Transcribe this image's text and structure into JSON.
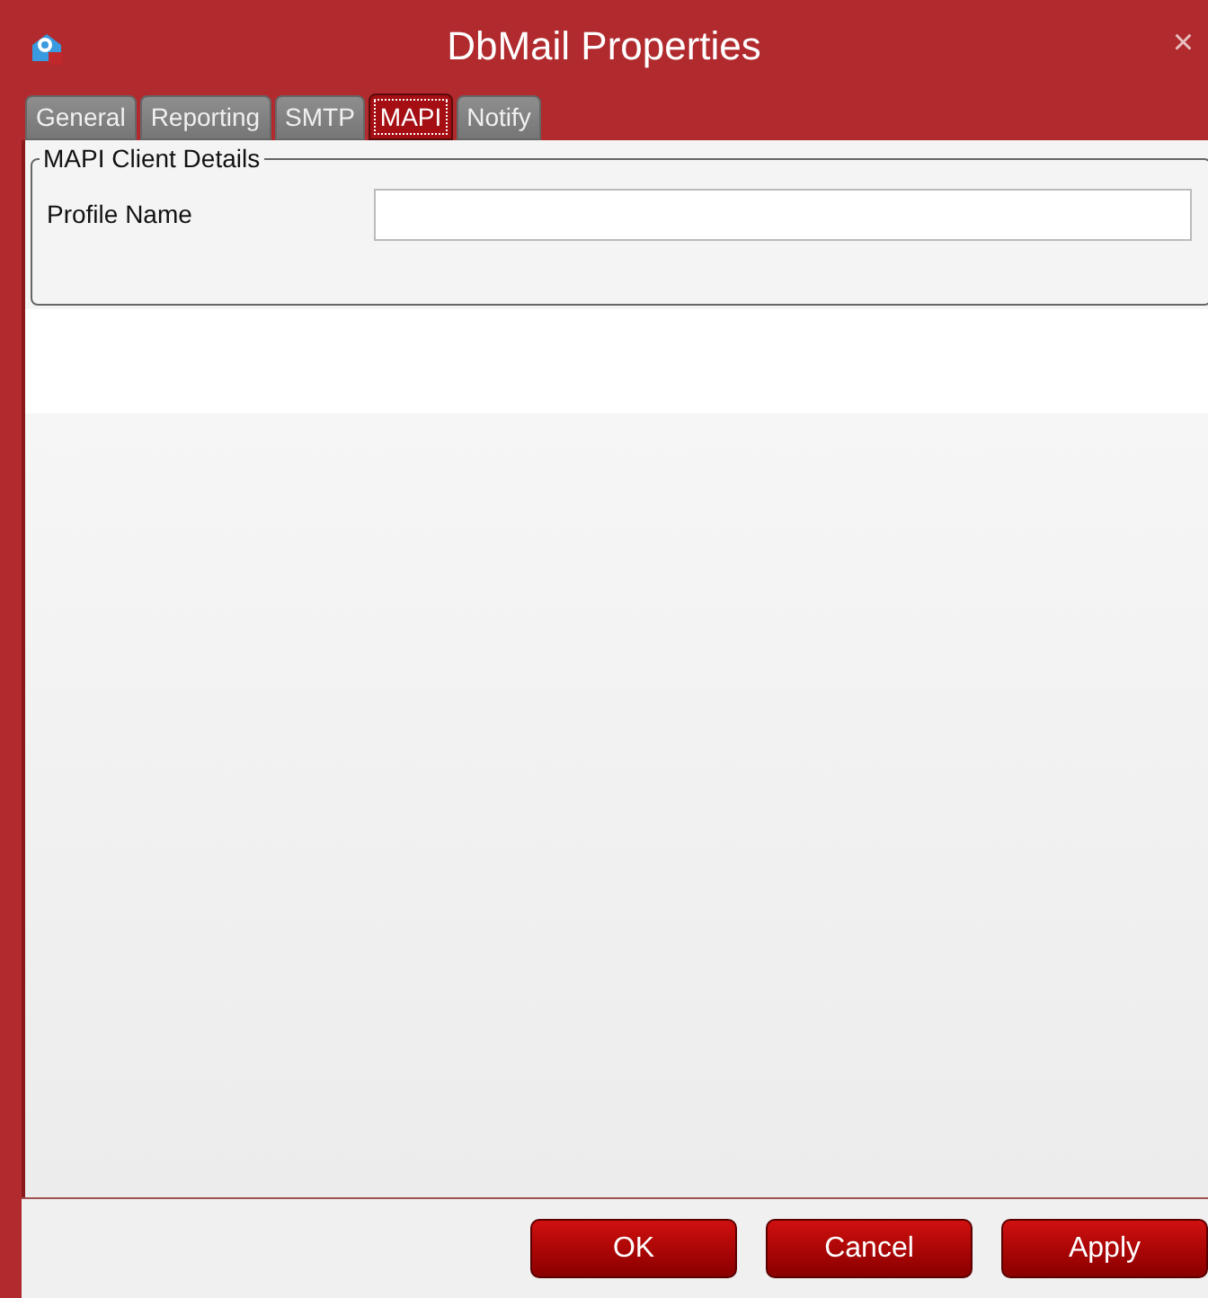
{
  "window": {
    "title": "DbMail Properties",
    "close": "×"
  },
  "tabs": [
    {
      "label": "General",
      "selected": false
    },
    {
      "label": "Reporting",
      "selected": false
    },
    {
      "label": "SMTP",
      "selected": false
    },
    {
      "label": "MAPI",
      "selected": true
    },
    {
      "label": "Notify",
      "selected": false
    }
  ],
  "group": {
    "title": "MAPI Client Details",
    "fields": [
      {
        "label": "Profile Name"
      }
    ]
  },
  "buttons": [
    "OK",
    "Cancel",
    "Apply"
  ]
}
